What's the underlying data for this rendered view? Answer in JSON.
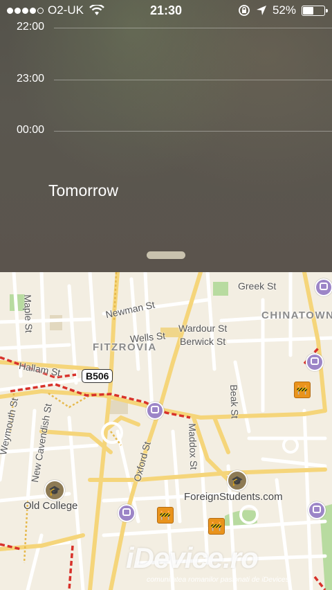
{
  "status_bar": {
    "carrier": "O2-UK",
    "signal_bars": 4,
    "time": "21:30",
    "battery_percent": "52%",
    "battery_level": 0.52,
    "icons": [
      "wifi-icon",
      "rotation-lock-icon",
      "location-arrow-icon",
      "battery-icon"
    ]
  },
  "notification_center": {
    "hours": [
      "22:00",
      "23:00",
      "00:00"
    ],
    "tomorrow_label": "Tomorrow"
  },
  "map": {
    "districts": [
      "FITZROVIA",
      "CHINATOWN"
    ],
    "streets": [
      "Maple St",
      "Newman St",
      "Greek St",
      "Wardour St",
      "Berwick St",
      "Wells St",
      "Hallam St",
      "Weymouth St",
      "New Cavendish St",
      "Beak St",
      "Oxford St",
      "Maddox St"
    ],
    "road_shield": "B506",
    "pois": [
      "Old College",
      "ForeignStudents.com"
    ],
    "icons": [
      "tube-station-icon",
      "roadworks-icon",
      "college-icon"
    ]
  },
  "watermark": {
    "title": "iDevice.ro",
    "subtitle": "comunitatea romanilor pasionati de iDevices"
  }
}
